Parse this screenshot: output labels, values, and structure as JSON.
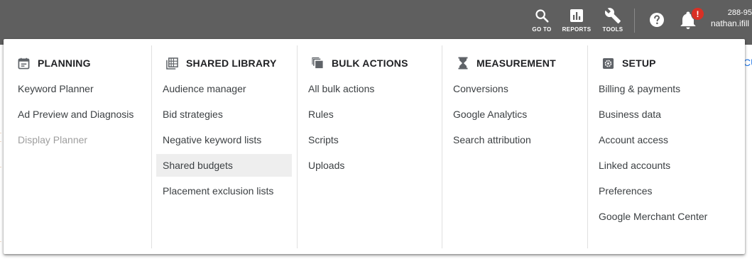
{
  "topbar": {
    "goto_label": "GO TO",
    "reports_label": "REPORTS",
    "tools_label": "TOOLS",
    "notification_badge": "!",
    "account_id": "288-95",
    "account_email": "nathan.ifill"
  },
  "background": {
    "link_fragment": "CU"
  },
  "menu": {
    "columns": [
      {
        "heading": "PLANNING",
        "icon": "calendar-icon",
        "items": [
          {
            "label": "Keyword Planner"
          },
          {
            "label": "Ad Preview and Diagnosis"
          },
          {
            "label": "Display Planner",
            "state": "disabled"
          }
        ]
      },
      {
        "heading": "SHARED LIBRARY",
        "icon": "library-grid-icon",
        "items": [
          {
            "label": "Audience manager"
          },
          {
            "label": "Bid strategies"
          },
          {
            "label": "Negative keyword lists"
          },
          {
            "label": "Shared budgets",
            "state": "hovered"
          },
          {
            "label": "Placement exclusion lists"
          }
        ]
      },
      {
        "heading": "BULK ACTIONS",
        "icon": "copy-stack-icon",
        "items": [
          {
            "label": "All bulk actions"
          },
          {
            "label": "Rules"
          },
          {
            "label": "Scripts"
          },
          {
            "label": "Uploads"
          }
        ]
      },
      {
        "heading": "MEASUREMENT",
        "icon": "hourglass-icon",
        "items": [
          {
            "label": "Conversions"
          },
          {
            "label": "Google Analytics"
          },
          {
            "label": "Search attribution"
          }
        ]
      },
      {
        "heading": "SETUP",
        "icon": "settings-gear-icon",
        "items": [
          {
            "label": "Billing & payments"
          },
          {
            "label": "Business data"
          },
          {
            "label": "Account access"
          },
          {
            "label": "Linked accounts"
          },
          {
            "label": "Preferences"
          },
          {
            "label": "Google Merchant Center"
          }
        ]
      }
    ]
  },
  "colors": {
    "topbar_bg": "#5f5f5f",
    "badge_red": "#d93025",
    "hover_bg": "#eeeeee",
    "disabled_text": "#9e9e9e",
    "link_blue": "#1a73e8"
  }
}
